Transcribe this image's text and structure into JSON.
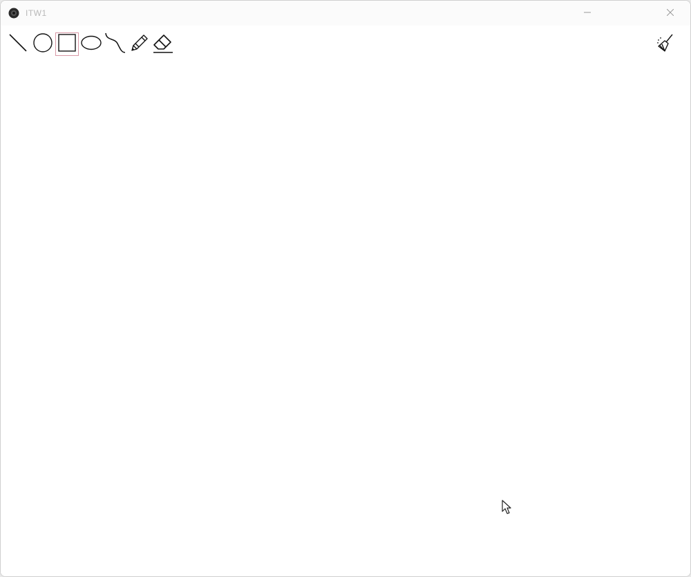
{
  "window": {
    "title": "ITW1"
  },
  "icons": {
    "app": "app-circle-icon",
    "minimize": "minimize-icon",
    "close": "close-icon",
    "clear": "broom-icon",
    "cursor": "mouse-pointer-icon"
  },
  "toolbar": {
    "tools": [
      {
        "name": "line-tool",
        "icon": "line-icon"
      },
      {
        "name": "circle-tool",
        "icon": "circle-icon"
      },
      {
        "name": "rectangle-tool",
        "icon": "rectangle-icon",
        "selected": true
      },
      {
        "name": "ellipse-tool",
        "icon": "ellipse-icon"
      },
      {
        "name": "curve-tool",
        "icon": "curve-icon"
      },
      {
        "name": "pencil-tool",
        "icon": "pencil-icon"
      },
      {
        "name": "eraser-tool",
        "icon": "eraser-icon"
      }
    ]
  },
  "colors": {
    "selected_outline": "#d998a6",
    "stroke": "#111111",
    "title_text": "#b8b8b8"
  }
}
